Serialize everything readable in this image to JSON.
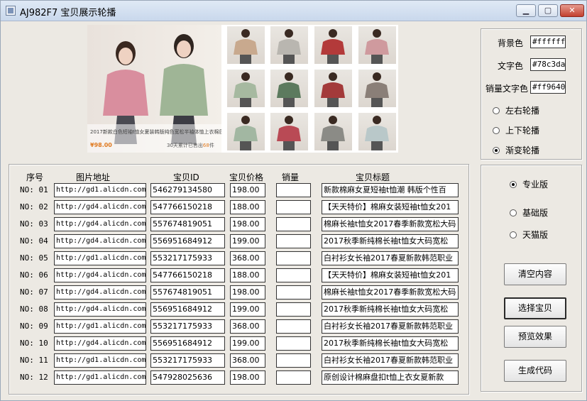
{
  "window": {
    "title": "AJ982F7 宝贝展示轮播",
    "controls": [
      "minimize",
      "maximize",
      "close"
    ]
  },
  "preview": {
    "promo_text": "2017新款白色短袖t恤女夏装韩版纯色宽松半袖体恤上衣棉质打底衫",
    "price": "¥98.00",
    "sold_text": "30天累计已售出",
    "sold_count": "68",
    "sold_suffix": "件",
    "thumb_colors": [
      "#c8a98e",
      "#b9b6b0",
      "#b33a3a",
      "#cf9a9e",
      "#a6b9a0",
      "#5c7a5e",
      "#a33a3a",
      "#8a7f78",
      "#a2b7a2",
      "#b94a55",
      "#8b8b86",
      "#b9c8c9"
    ]
  },
  "settings": {
    "bg_color_label": "背景色",
    "bg_color_value": "#ffffff",
    "text_color_label": "文字色",
    "text_color_value": "#78c3da",
    "sales_color_label": "销量文字色",
    "sales_color_value": "#ff9640",
    "carousel_modes": [
      "左右轮播",
      "上下轮播",
      "渐变轮播"
    ],
    "carousel_selected": 2
  },
  "table": {
    "headers": {
      "no": "序号",
      "url": "图片地址",
      "id": "宝贝ID",
      "price": "宝贝价格",
      "sales": "销量",
      "title": "宝贝标题"
    },
    "rows": [
      {
        "no": "NO: 01",
        "url": "http://gd1.alicdn.com",
        "id": "546279134580",
        "price": "198.00",
        "sales": "",
        "title": "新款棉麻女夏短袖t恤潮 韩版个性百"
      },
      {
        "no": "NO: 02",
        "url": "http://gd4.alicdn.com",
        "id": "547766150218",
        "price": "188.00",
        "sales": "",
        "title": "【天天特价】棉麻女装短袖t恤女201"
      },
      {
        "no": "NO: 03",
        "url": "http://gd4.alicdn.com",
        "id": "557674819051",
        "price": "198.00",
        "sales": "",
        "title": "棉麻长袖t恤女2017春季新款宽松大码"
      },
      {
        "no": "NO: 04",
        "url": "http://gd4.alicdn.com",
        "id": "556951684912",
        "price": "199.00",
        "sales": "",
        "title": "2017秋季新纯棉长袖t恤女大码宽松"
      },
      {
        "no": "NO: 05",
        "url": "http://gd1.alicdn.com",
        "id": "553217175933",
        "price": "368.00",
        "sales": "",
        "title": "白衬衫女长袖2017春夏新款韩范职业"
      },
      {
        "no": "NO: 06",
        "url": "http://gd4.alicdn.com",
        "id": "547766150218",
        "price": "188.00",
        "sales": "",
        "title": "【天天特价】棉麻女装短袖t恤女201"
      },
      {
        "no": "NO: 07",
        "url": "http://gd4.alicdn.com",
        "id": "557674819051",
        "price": "198.00",
        "sales": "",
        "title": "棉麻长袖t恤女2017春季新款宽松大码"
      },
      {
        "no": "NO: 08",
        "url": "http://gd4.alicdn.com",
        "id": "556951684912",
        "price": "199.00",
        "sales": "",
        "title": "2017秋季新纯棉长袖t恤女大码宽松"
      },
      {
        "no": "NO: 09",
        "url": "http://gd1.alicdn.com",
        "id": "553217175933",
        "price": "368.00",
        "sales": "",
        "title": "白衬衫女长袖2017春夏新款韩范职业"
      },
      {
        "no": "NO: 10",
        "url": "http://gd4.alicdn.com",
        "id": "556951684912",
        "price": "199.00",
        "sales": "",
        "title": "2017秋季新纯棉长袖t恤女大码宽松"
      },
      {
        "no": "NO: 11",
        "url": "http://gd1.alicdn.com",
        "id": "553217175933",
        "price": "368.00",
        "sales": "",
        "title": "白衬衫女长袖2017春夏新款韩范职业"
      },
      {
        "no": "NO: 12",
        "url": "http://gd1.alicdn.com",
        "id": "547928025636",
        "price": "198.00",
        "sales": "",
        "title": "原创设计棉麻盘扣t恤上衣女夏新款"
      }
    ]
  },
  "edition": {
    "options": [
      "专业版",
      "基础版",
      "天猫版"
    ],
    "selected": 0
  },
  "buttons": {
    "clear": "清空内容",
    "select": "选择宝贝",
    "preview": "预览效果",
    "generate": "生成代码"
  }
}
